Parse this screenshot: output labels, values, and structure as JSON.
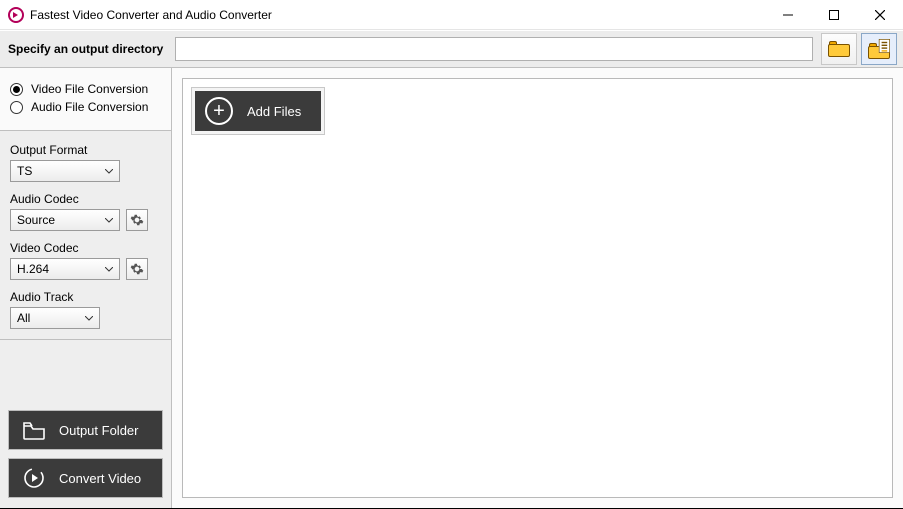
{
  "window": {
    "title": "Fastest Video Converter and Audio Converter"
  },
  "toolbar": {
    "output_label": "Specify an output directory",
    "output_value": ""
  },
  "mode": {
    "video_label": "Video File Conversion",
    "audio_label": "Audio File Conversion",
    "selected": "video"
  },
  "settings": {
    "output_format": {
      "label": "Output Format",
      "value": "TS"
    },
    "audio_codec": {
      "label": "Audio Codec",
      "value": "Source"
    },
    "video_codec": {
      "label": "Video Codec",
      "value": "H.264"
    },
    "audio_track": {
      "label": "Audio Track",
      "value": "All"
    }
  },
  "actions": {
    "output_folder": "Output Folder",
    "convert": "Convert Video",
    "add_files": "Add Files"
  }
}
